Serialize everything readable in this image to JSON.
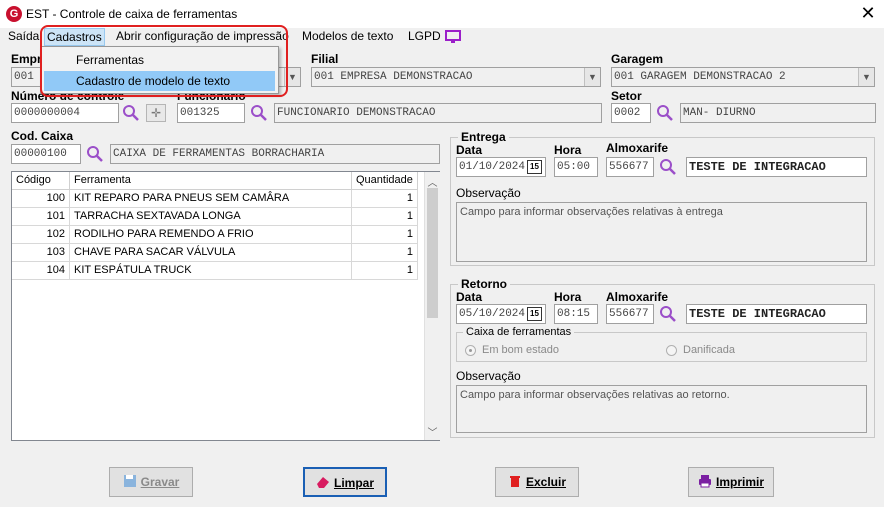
{
  "window": {
    "title": "EST - Controle de caixa de ferramentas",
    "app_icon_letter": "G",
    "close_glyph": "✕"
  },
  "menu": {
    "items": [
      "Saída",
      "Cadastros",
      "Abrir configuração de impressão",
      "Modelos de texto",
      "LGPD"
    ],
    "active": "Cadastros",
    "dropdown": [
      "Ferramentas",
      "Cadastro de modelo de texto"
    ],
    "dropdown_highlighted": "Cadastro de modelo de texto"
  },
  "header": {
    "empresa_label": "Empresa",
    "empresa_value": "001 E",
    "filial_label": "Filial",
    "filial_value": "001 EMPRESA DEMONSTRACAO",
    "garagem_label": "Garagem",
    "garagem_value": "001 GARAGEM DEMONSTRACAO 2",
    "numero_label": "Número de controle",
    "numero_value": "0000000004",
    "funcionario_label": "Funcionario",
    "funcionario_code": "001325",
    "funcionario_name": "FUNCIONARIO DEMONSTRACAO",
    "setor_label": "Setor",
    "setor_code": "0002",
    "setor_name": "MAN- DIURNO",
    "cod_caixa_label": "Cod. Caixa",
    "cod_caixa_value": "00000100",
    "caixa_name": "CAIXA DE FERRAMENTAS BORRACHARIA"
  },
  "grid": {
    "columns": [
      "Código",
      "Ferramenta",
      "Quantidade"
    ],
    "rows": [
      [
        "100",
        "KIT REPARO PARA PNEUS SEM CAMÂRA",
        "1"
      ],
      [
        "101",
        "TARRACHA SEXTAVADA LONGA",
        "1"
      ],
      [
        "102",
        "RODILHO PARA REMENDO A FRIO",
        "1"
      ],
      [
        "103",
        "CHAVE PARA SACAR VÁLVULA",
        "1"
      ],
      [
        "104",
        "KIT ESPÁTULA TRUCK",
        "1"
      ]
    ]
  },
  "entrega": {
    "title": "Entrega",
    "data_label": "Data",
    "data_value": "01/10/2024",
    "hora_label": "Hora",
    "hora_value": "05:00",
    "almox_label": "Almoxarife",
    "almox_code": "556677",
    "almox_name": "TESTE DE INTEGRACAO",
    "obs_label": "Observação",
    "obs_placeholder": "Campo para informar observações relativas à entrega"
  },
  "retorno": {
    "title": "Retorno",
    "data_label": "Data",
    "data_value": "05/10/2024",
    "hora_label": "Hora",
    "hora_value": "08:15",
    "almox_label": "Almoxarife",
    "almox_code": "556677",
    "almox_name": "TESTE DE INTEGRACAO",
    "caixa_group_label": "Caixa de ferramentas",
    "radio_bom": "Em bom estado",
    "radio_danificada": "Danificada",
    "obs_label": "Observação",
    "obs_placeholder": "Campo para informar observações relativas ao retorno."
  },
  "buttons": {
    "gravar": "Gravar",
    "limpar": "Limpar",
    "excluir": "Excluir",
    "imprimir": "Imprimir"
  },
  "calendar_glyph": "15",
  "colors": {
    "accent_red": "#e02020",
    "menu_highlight": "#91c9f7",
    "magnifier": "#9b4fc9",
    "brand": "#c8102e"
  }
}
